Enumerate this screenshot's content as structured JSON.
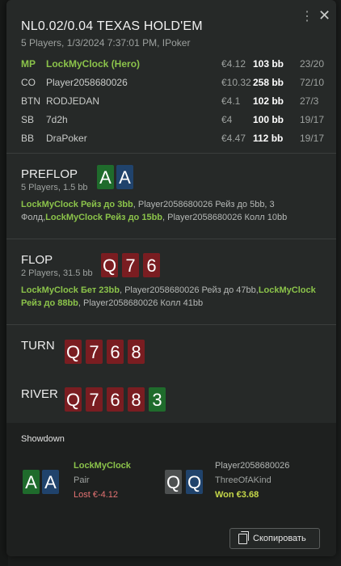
{
  "header": {
    "title": "NL0.02/0.04 TEXAS HOLD'EM",
    "subtitle": "5 Players, 1/3/2024 7:37:01 PM, IPoker"
  },
  "players": [
    {
      "pos": "MP",
      "name": "LockMyClock (Hero)",
      "money": "€4.12",
      "bb": "103 bb",
      "ratio": "23/20",
      "hero": true
    },
    {
      "pos": "CO",
      "name": "Player2058680026",
      "money": "€10.32",
      "bb": "258 bb",
      "ratio": "72/10"
    },
    {
      "pos": "BTN",
      "name": "RODJEDAN",
      "money": "€4.1",
      "bb": "102 bb",
      "ratio": "27/3"
    },
    {
      "pos": "SB",
      "name": "7d2h",
      "money": "€4",
      "bb": "100 bb",
      "ratio": "19/17"
    },
    {
      "pos": "BB",
      "name": "DraPoker",
      "money": "€4.47",
      "bb": "112 bb",
      "ratio": "19/17"
    }
  ],
  "streets": {
    "preflop": {
      "name": "PREFLOP",
      "sub": "5 Players, 1.5 bb",
      "cards": [
        {
          "rank": "A",
          "suit": "green"
        },
        {
          "rank": "A",
          "suit": "blue"
        }
      ],
      "actions": [
        {
          "text": "LockMyClock Рейз до 3bb",
          "hero": true
        },
        {
          "text": ", Player2058680026 Рейз до 5bb, 3 Фолд,",
          "hero": false
        },
        {
          "text": "LockMyClock Рейз до 15bb",
          "hero": true
        },
        {
          "text": ", Player2058680026 Колл 10bb",
          "hero": false
        }
      ]
    },
    "flop": {
      "name": "FLOP",
      "sub": "2 Players, 31.5 bb",
      "cards": [
        {
          "rank": "Q",
          "suit": "red"
        },
        {
          "rank": "7",
          "suit": "red"
        },
        {
          "rank": "6",
          "suit": "red"
        }
      ],
      "actions": [
        {
          "text": "LockMyClock Бет 23bb",
          "hero": true
        },
        {
          "text": ", Player2058680026 Рейз до 47bb,",
          "hero": false
        },
        {
          "text": "LockMyClock Рейз до 88bb",
          "hero": true
        },
        {
          "text": ", Player2058680026 Колл 41bb",
          "hero": false
        }
      ]
    },
    "turn": {
      "name": "TURN",
      "cards": [
        {
          "rank": "Q",
          "suit": "red"
        },
        {
          "rank": "7",
          "suit": "red"
        },
        {
          "rank": "6",
          "suit": "red"
        },
        {
          "rank": "8",
          "suit": "red"
        }
      ]
    },
    "river": {
      "name": "RIVER",
      "cards": [
        {
          "rank": "Q",
          "suit": "red"
        },
        {
          "rank": "7",
          "suit": "red"
        },
        {
          "rank": "6",
          "suit": "red"
        },
        {
          "rank": "8",
          "suit": "red"
        },
        {
          "rank": "3",
          "suit": "green"
        }
      ]
    }
  },
  "showdown": {
    "title": "Showdown",
    "hands": [
      {
        "cards": [
          {
            "rank": "A",
            "suit": "green"
          },
          {
            "rank": "A",
            "suit": "blue"
          }
        ],
        "name": "LockMyClock",
        "hand": "Pair",
        "result": "Lost €-4.12",
        "hero": true,
        "won": false
      },
      {
        "cards": [
          {
            "rank": "Q",
            "suit": "gray"
          },
          {
            "rank": "Q",
            "suit": "blue"
          }
        ],
        "name": "Player2058680026",
        "hand": "ThreeOfAKind",
        "result": "Won €3.68",
        "hero": false,
        "won": true
      }
    ],
    "copy_label": "Скопировать"
  },
  "colors": {
    "hero": "#8bc34a",
    "won": "#c6d84a",
    "lost": "#e57373",
    "card_red": "#7a1d21",
    "card_green": "#1f6b2c",
    "card_blue": "#20436c",
    "card_gray": "#4d5050"
  },
  "icons": {
    "menu": "kebab-menu-icon",
    "close": "close-icon",
    "copy": "copy-icon"
  }
}
